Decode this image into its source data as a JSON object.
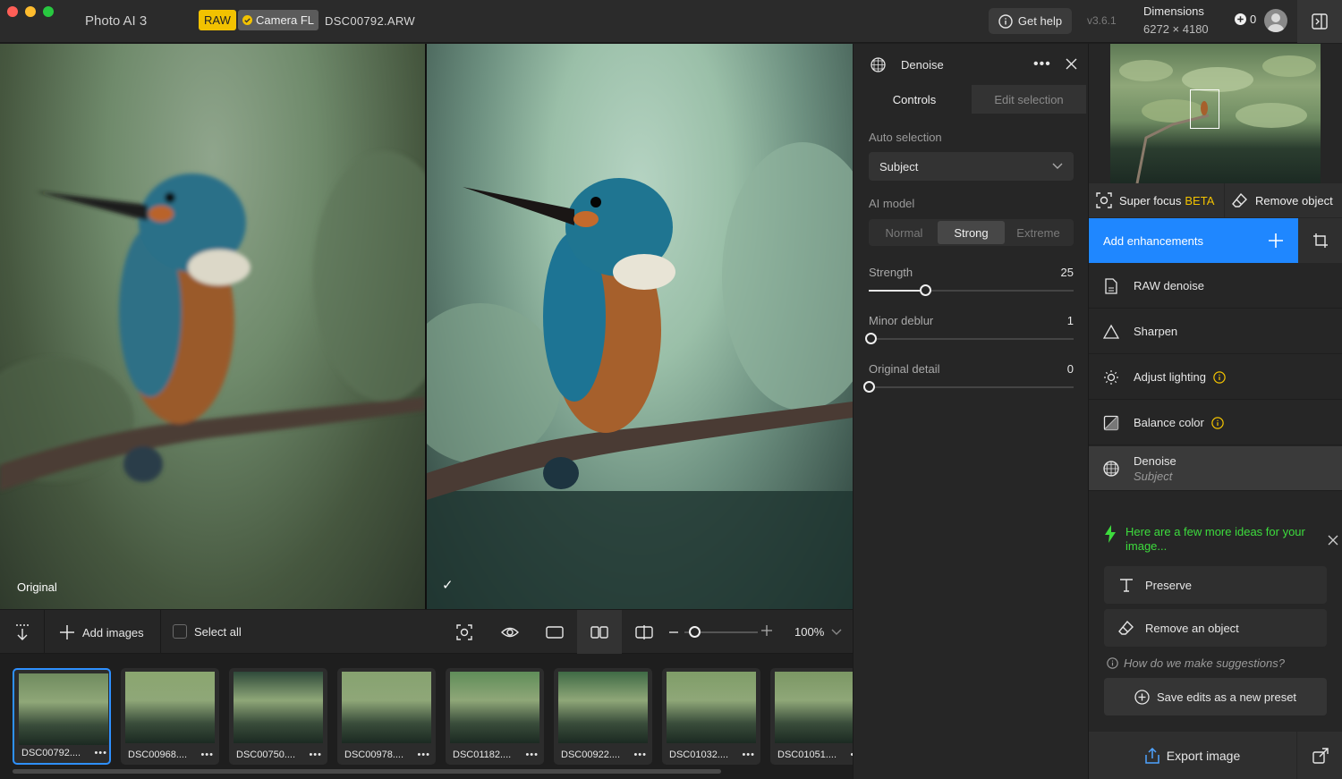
{
  "window": {
    "app_title": "Photo AI  3"
  },
  "header": {
    "raw_badge": "RAW",
    "camera_badge": "Camera FL",
    "filename": "DSC00792.ARW",
    "get_help": "Get help",
    "version": "v3.6.1",
    "dimensions_label": "Dimensions",
    "dimensions_value": "6272 × 4180",
    "credits": "0"
  },
  "viewer": {
    "left_label": "Original"
  },
  "toolbar": {
    "add_images": "Add images",
    "select_all": "Select all",
    "zoom": "100%"
  },
  "filmstrip": [
    {
      "name": "DSC00792....",
      "selected": true
    },
    {
      "name": "DSC00968....",
      "selected": false
    },
    {
      "name": "DSC00750....",
      "selected": false
    },
    {
      "name": "DSC00978....",
      "selected": false
    },
    {
      "name": "DSC01182....",
      "selected": false
    },
    {
      "name": "DSC00922....",
      "selected": false
    },
    {
      "name": "DSC01032....",
      "selected": false
    },
    {
      "name": "DSC01051....",
      "selected": false
    }
  ],
  "denoise_panel": {
    "title": "Denoise",
    "tabs": [
      "Controls",
      "Edit selection"
    ],
    "auto_selection_label": "Auto selection",
    "auto_selection_value": "Subject",
    "ai_model_label": "AI model",
    "ai_model_options": [
      "Normal",
      "Strong",
      "Extreme"
    ],
    "ai_model_selected": "Strong",
    "sliders": [
      {
        "label": "Strength",
        "value": 25,
        "max": 100
      },
      {
        "label": "Minor deblur",
        "value": 1,
        "max": 100
      },
      {
        "label": "Original detail",
        "value": 0,
        "max": 100
      }
    ]
  },
  "right_panel": {
    "super_focus": "Super focus",
    "super_focus_tag": "BETA",
    "remove_object": "Remove object",
    "add_enhancements": "Add enhancements",
    "enhancements": [
      {
        "label": "RAW denoise",
        "sub": "",
        "icon": "raw-file-icon",
        "info": false
      },
      {
        "label": "Sharpen",
        "sub": "",
        "icon": "triangle-icon",
        "info": false
      },
      {
        "label": "Adjust lighting",
        "sub": "",
        "icon": "sun-icon",
        "info": true
      },
      {
        "label": "Balance color",
        "sub": "",
        "icon": "color-square-icon",
        "info": true
      },
      {
        "label": "Denoise",
        "sub": "Subject",
        "icon": "denoise-icon",
        "info": false
      }
    ],
    "suggestion_text": "Here are a few more ideas for your image...",
    "suggestions": [
      "Preserve",
      "Remove an object"
    ],
    "how_suggestions": "How do we make suggestions?",
    "save_preset": "Save edits as a new preset",
    "export": "Export image"
  },
  "colors": {
    "accent": "#1f87ff",
    "raw_badge": "#f2c200",
    "suggestion_green": "#3ddc3d"
  }
}
